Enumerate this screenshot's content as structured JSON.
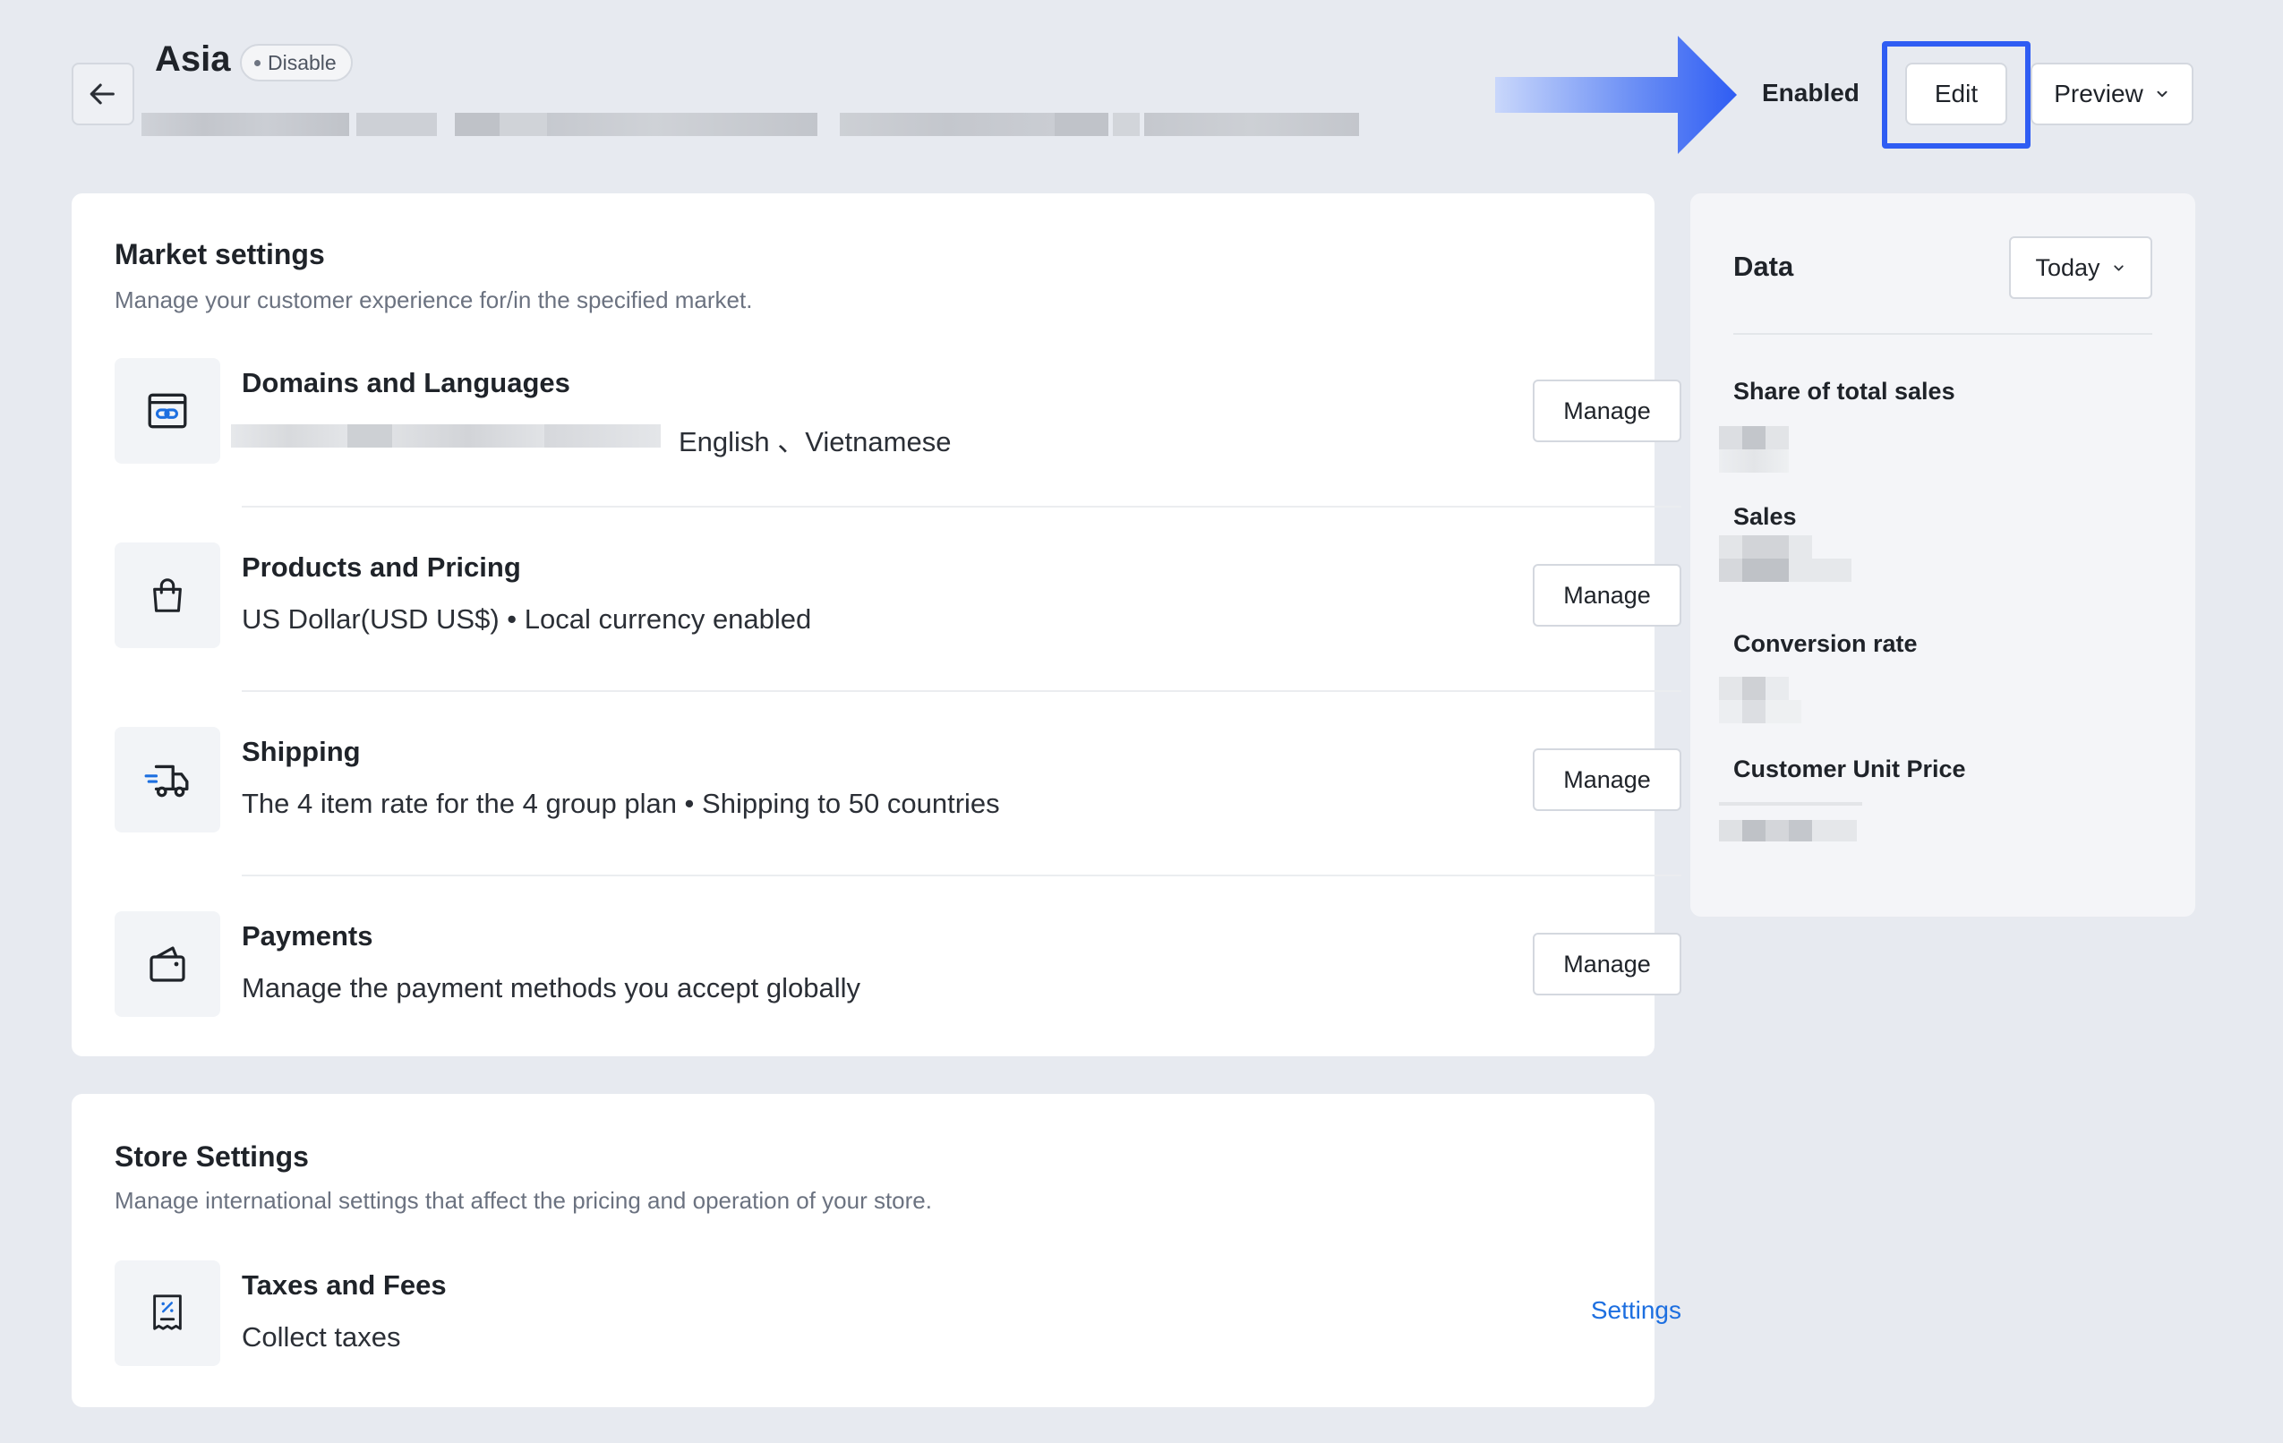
{
  "header": {
    "title": "Asia",
    "status_badge": "Disable",
    "status_label": "Enabled",
    "edit_label": "Edit",
    "preview_label": "Preview"
  },
  "market_settings": {
    "title": "Market settings",
    "description": "Manage your customer experience for/in the specified market.",
    "rows": [
      {
        "title": "Domains and Languages",
        "subtitle": "English 、Vietnamese",
        "action": "Manage",
        "icon": "domain-link-icon"
      },
      {
        "title": "Products and Pricing",
        "subtitle": "US Dollar(USD US$)  •  Local currency enabled",
        "action": "Manage",
        "icon": "shopping-bag-icon"
      },
      {
        "title": "Shipping",
        "subtitle": "The 4 item rate for the 4 group plan  •  Shipping to 50 countries",
        "action": "Manage",
        "icon": "delivery-truck-icon"
      },
      {
        "title": "Payments",
        "subtitle": "Manage the payment methods you accept globally",
        "action": "Manage",
        "icon": "wallet-icon"
      }
    ]
  },
  "store_settings": {
    "title": "Store Settings",
    "description": "Manage international settings that affect the pricing and operation of your store.",
    "rows": [
      {
        "title": "Taxes and Fees",
        "subtitle": "Collect taxes",
        "action": "Settings",
        "icon": "tax-receipt-icon"
      }
    ]
  },
  "data_panel": {
    "title": "Data",
    "range": "Today",
    "metrics": [
      {
        "label": "Share of total sales"
      },
      {
        "label": "Sales"
      },
      {
        "label": "Conversion rate"
      },
      {
        "label": "Customer Unit Price"
      }
    ]
  },
  "colors": {
    "page_bg": "#e7eaf0",
    "annotation_blue": "#2f5df3",
    "link_blue": "#1d6fe0",
    "card_bg": "#ffffff"
  }
}
